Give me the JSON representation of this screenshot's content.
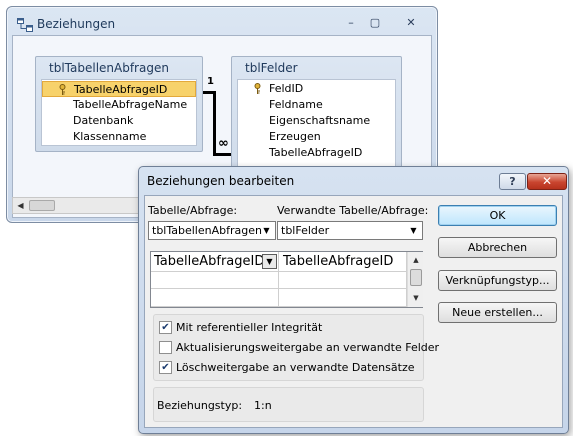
{
  "relationships_window": {
    "title": "Beziehungen",
    "app_icon": "relationships-icon",
    "caption_buttons": {
      "minimize": "–",
      "maximize": "▢",
      "close": "✕"
    }
  },
  "tables": [
    {
      "name": "tblTabellenAbfragen",
      "fields": [
        {
          "label": "TabelleAbfrageID",
          "primary_key": true,
          "selected": true
        },
        {
          "label": "TabelleAbfrageName",
          "primary_key": false,
          "selected": false
        },
        {
          "label": "Datenbank",
          "primary_key": false,
          "selected": false
        },
        {
          "label": "Klassenname",
          "primary_key": false,
          "selected": false
        }
      ]
    },
    {
      "name": "tblFelder",
      "fields": [
        {
          "label": "FeldID",
          "primary_key": true,
          "selected": false
        },
        {
          "label": "Feldname",
          "primary_key": false,
          "selected": false
        },
        {
          "label": "Eigenschaftsname",
          "primary_key": false,
          "selected": false
        },
        {
          "label": "Erzeugen",
          "primary_key": false,
          "selected": false
        },
        {
          "label": "TabelleAbfrageID",
          "primary_key": false,
          "selected": false
        }
      ]
    }
  ],
  "relationship_line": {
    "one_side": "1",
    "many_side": "∞"
  },
  "dialog": {
    "title": "Beziehungen bearbeiten",
    "help_button": "?",
    "close_button": "✕",
    "table_query_label": "Tabelle/Abfrage:",
    "related_table_label": "Verwandte Tabelle/Abfrage:",
    "table_query_value": "tblTabellenAbfragen",
    "related_table_value": "tblFelder",
    "join_rows": [
      {
        "left": "TabelleAbfrageID",
        "right": "TabelleAbfrageID"
      },
      {
        "left": "",
        "right": ""
      },
      {
        "left": "",
        "right": ""
      }
    ],
    "checkboxes": [
      {
        "label": "Mit referentieller Integrität",
        "checked": true
      },
      {
        "label": "Aktualisierungsweitergabe an verwandte Felder",
        "checked": false
      },
      {
        "label": "Löschweitergabe an verwandte Datensätze",
        "checked": true
      }
    ],
    "relationship_type_label": "Beziehungstyp:",
    "relationship_type_value": "1:n",
    "buttons": {
      "ok": "OK",
      "cancel": "Abbrechen",
      "join_type": "Verknüpfungstyp...",
      "create_new": "Neue erstellen..."
    }
  },
  "colors": {
    "selected_field": "#f7d26b",
    "window_frame": "#c9d7ea",
    "close_button": "#c9452f",
    "default_button": "#bee6fd"
  }
}
